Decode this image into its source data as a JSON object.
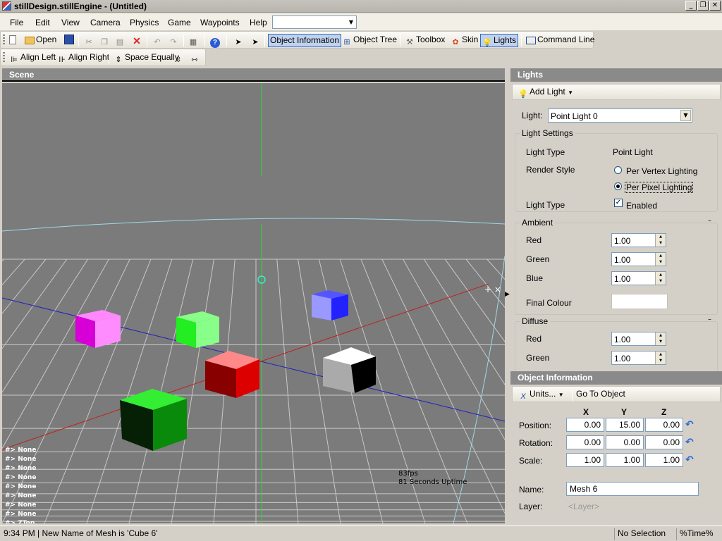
{
  "window": {
    "title": "stillDesign.stillEngine - (Untitled)",
    "buttons": [
      "_",
      "❐",
      "✕"
    ]
  },
  "menu": {
    "items": [
      "File",
      "Edit",
      "View",
      "Camera",
      "Physics",
      "Game",
      "Waypoints",
      "Help"
    ],
    "combo_value": ""
  },
  "toolbar": {
    "open": "Open",
    "object_information": "Object Information",
    "object_tree": "Object Tree",
    "toolbox": "Toolbox",
    "skin": "Skin",
    "lights": "Lights",
    "command_line": "Command Line"
  },
  "align_toolbar": {
    "align_left": "Align Left",
    "align_right": "Align Right",
    "space_equally": "Space Equally"
  },
  "scene": {
    "header": "Scene",
    "overlay_lines": "#> None\n#> None\n#> None\n#> None\n#> None\n#> None\n#> None\n#> None\n#> ZTop",
    "fps": "83fps",
    "uptime": "81 Seconds Uptime",
    "cubes": [
      {
        "name": "magenta-cube",
        "color": "#ff00ff"
      },
      {
        "name": "green-cube",
        "color": "#33ff33"
      },
      {
        "name": "blue-cube",
        "color": "#3333ff"
      },
      {
        "name": "red-cube",
        "color": "#dd0000"
      },
      {
        "name": "white-cube",
        "color": "#ffffff"
      },
      {
        "name": "dark-green-cube",
        "color": "#008800"
      }
    ]
  },
  "lights": {
    "header": "Lights",
    "add_light": "Add Light",
    "light_label": "Light:",
    "light_value": "Point Light 0",
    "settings_title": "Light Settings",
    "light_type_label": "Light Type",
    "light_type_value": "Point Light",
    "render_style_label": "Render Style",
    "per_vertex": "Per Vertex Lighting",
    "per_pixel": "Per Pixel Lighting",
    "render_style_selected": "Per Pixel Lighting",
    "enabled_label": "Light Type",
    "enabled_text": "Enabled",
    "enabled_checked": true,
    "ambient": {
      "title": "Ambient",
      "red_label": "Red",
      "red": "1.00",
      "green_label": "Green",
      "green": "1.00",
      "blue_label": "Blue",
      "blue": "1.00",
      "final_label": "Final Colour",
      "final_color": "#ffffff"
    },
    "diffuse": {
      "title": "Diffuse",
      "red_label": "Red",
      "red": "1.00",
      "green_label": "Green",
      "green": "1.00"
    }
  },
  "object_info": {
    "header": "Object Information",
    "units": "Units...",
    "go_to_object": "Go To Object",
    "col_x": "X",
    "col_y": "Y",
    "col_z": "Z",
    "position_label": "Position:",
    "position": [
      "0.00",
      "15.00",
      "0.00"
    ],
    "rotation_label": "Rotation:",
    "rotation": [
      "0.00",
      "0.00",
      "0.00"
    ],
    "scale_label": "Scale:",
    "scale": [
      "1.00",
      "1.00",
      "1.00"
    ],
    "name_label": "Name:",
    "name_value": "Mesh 6",
    "layer_label": "Layer:",
    "layer_placeholder": "<Layer>"
  },
  "status": {
    "message": "9:34 PM | New Name of Mesh is 'Cube 6'",
    "selection": "No Selection",
    "time": "%Time%"
  }
}
